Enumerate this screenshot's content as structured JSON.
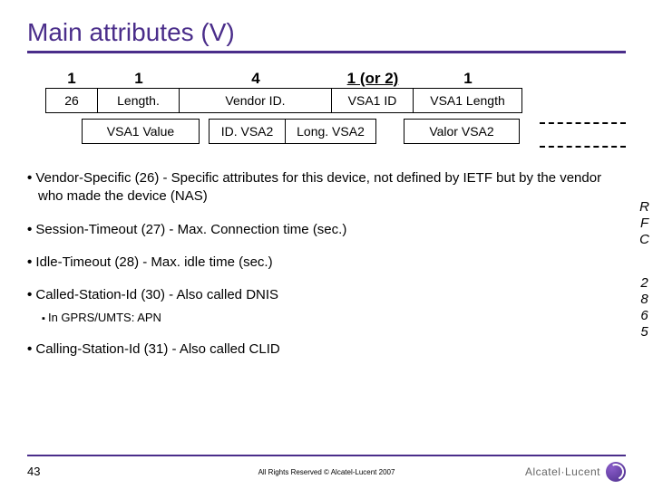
{
  "title": "Main attributes (V)",
  "diagram": {
    "row1_nums": {
      "n0": "1",
      "n1": "1",
      "n2": "4",
      "n3": "1 (or 2)",
      "n4": "1"
    },
    "row1_cells": {
      "c0": "26",
      "c1": "Length.",
      "c2": "Vendor ID.",
      "c3": "VSA1 ID",
      "c4": "VSA1 Length"
    },
    "row2_cells": {
      "b0": "VSA1 Value",
      "b1": "ID. VSA2",
      "b2": "Long. VSA2",
      "b3": "Valor VSA2"
    }
  },
  "bullets": {
    "b1": "Vendor-Specific (26) - Specific attributes for this device, not defined by IETF but by the vendor who made the device (NAS)",
    "b2": "Session-Timeout (27) - Max. Connection time (sec.)",
    "b3": "Idle-Timeout (28) - Max. idle time (sec.)",
    "b4": "Called-Station-Id (30) - Also called DNIS",
    "b4sub": "In GPRS/UMTS: APN",
    "b5": "Calling-Station-Id (31) - Also called CLID"
  },
  "sidetext": {
    "block1": "R\nF\nC",
    "block2": "2\n8\n6\n5"
  },
  "footer": {
    "page": "43",
    "copyright": "All Rights Reserved © Alcatel-Lucent 2007",
    "brand": "Alcatel·Lucent"
  }
}
